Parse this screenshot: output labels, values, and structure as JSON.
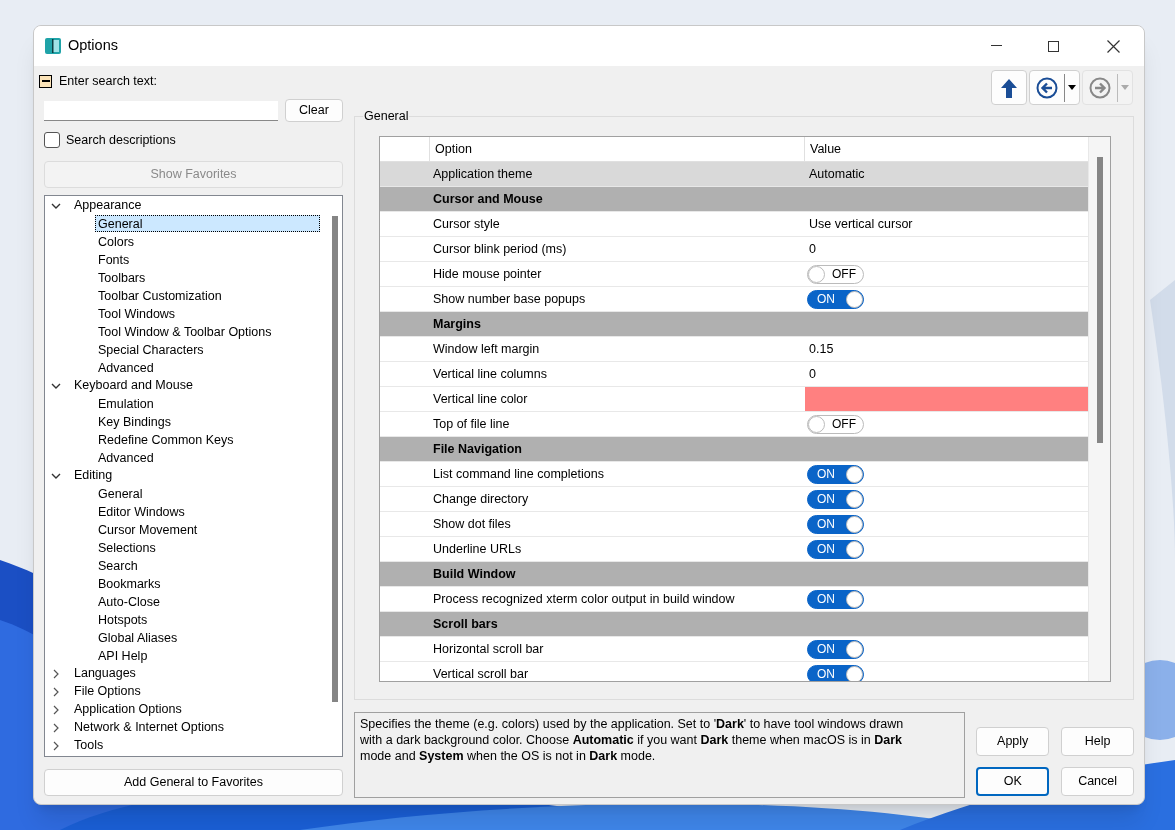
{
  "window": {
    "title": "Options"
  },
  "search": {
    "label": "Enter search text:",
    "expanded": true,
    "clear_button": "Clear",
    "descriptions": {
      "label": "Search descriptions",
      "checked": false
    },
    "show_favorites": {
      "label": "Show Favorites",
      "disabled": true
    }
  },
  "nav_buttons": [
    {
      "kind": "up",
      "disabled": false,
      "dropdown": false
    },
    {
      "kind": "back",
      "disabled": false,
      "dropdown": true
    },
    {
      "kind": "forward",
      "disabled": true,
      "dropdown": true
    }
  ],
  "tree": [
    {
      "label": "Appearance",
      "expanded": true,
      "selected": false,
      "children": [
        {
          "label": "General",
          "selected": true
        },
        {
          "label": "Colors",
          "selected": false
        },
        {
          "label": "Fonts",
          "selected": false
        },
        {
          "label": "Toolbars",
          "selected": false
        },
        {
          "label": "Toolbar Customization",
          "selected": false
        },
        {
          "label": "Tool Windows",
          "selected": false
        },
        {
          "label": "Tool Window & Toolbar Options",
          "selected": false
        },
        {
          "label": "Special Characters",
          "selected": false
        },
        {
          "label": "Advanced",
          "selected": false
        }
      ]
    },
    {
      "label": "Keyboard and Mouse",
      "expanded": true,
      "selected": false,
      "children": [
        {
          "label": "Emulation",
          "selected": false
        },
        {
          "label": "Key Bindings",
          "selected": false
        },
        {
          "label": "Redefine Common Keys",
          "selected": false
        },
        {
          "label": "Advanced",
          "selected": false
        }
      ]
    },
    {
      "label": "Editing",
      "expanded": true,
      "selected": false,
      "children": [
        {
          "label": "General",
          "selected": false
        },
        {
          "label": "Editor Windows",
          "selected": false
        },
        {
          "label": "Cursor Movement",
          "selected": false
        },
        {
          "label": "Selections",
          "selected": false
        },
        {
          "label": "Search",
          "selected": false
        },
        {
          "label": "Bookmarks",
          "selected": false
        },
        {
          "label": "Auto-Close",
          "selected": false
        },
        {
          "label": "Hotspots",
          "selected": false
        },
        {
          "label": "Global Aliases",
          "selected": false
        },
        {
          "label": "API Help",
          "selected": false
        }
      ]
    },
    {
      "label": "Languages",
      "expanded": false,
      "selected": false
    },
    {
      "label": "File Options",
      "expanded": false,
      "selected": false
    },
    {
      "label": "Application Options",
      "expanded": false,
      "selected": false
    },
    {
      "label": "Network & Internet Options",
      "expanded": false,
      "selected": false
    },
    {
      "label": "Tools",
      "expanded": false,
      "selected": false
    }
  ],
  "add_favorites_button": "Add General to Favorites",
  "group": {
    "title": "General"
  },
  "table": {
    "columns": [
      "Option",
      "Value"
    ],
    "rows": [
      {
        "kind": "text",
        "option": "Application theme",
        "value": "Automatic",
        "selected": true
      },
      {
        "kind": "section",
        "option": "Cursor and Mouse"
      },
      {
        "kind": "text",
        "option": "Cursor style",
        "value": "Use vertical cursor",
        "selected": false
      },
      {
        "kind": "text",
        "option": "Cursor blink period (ms)",
        "value": "0",
        "selected": false
      },
      {
        "kind": "toggle",
        "option": "Hide mouse pointer",
        "on": false,
        "value": "OFF",
        "selected": false
      },
      {
        "kind": "toggle",
        "option": "Show number base popups",
        "on": true,
        "value": "ON",
        "selected": false
      },
      {
        "kind": "section",
        "option": "Margins"
      },
      {
        "kind": "text",
        "option": "Window left margin",
        "value": "0.15",
        "selected": false
      },
      {
        "kind": "text",
        "option": "Vertical line columns",
        "value": "0",
        "selected": false
      },
      {
        "kind": "color",
        "option": "Vertical line color",
        "color": "#ff8080",
        "selected": false
      },
      {
        "kind": "toggle",
        "option": "Top of file line",
        "on": false,
        "value": "OFF",
        "selected": false
      },
      {
        "kind": "section",
        "option": "File Navigation"
      },
      {
        "kind": "toggle",
        "option": "List command line completions",
        "on": true,
        "value": "ON",
        "selected": false
      },
      {
        "kind": "toggle",
        "option": "Change directory",
        "on": true,
        "value": "ON",
        "selected": false
      },
      {
        "kind": "toggle",
        "option": "Show dot files",
        "on": true,
        "value": "ON",
        "selected": false
      },
      {
        "kind": "toggle",
        "option": "Underline URLs",
        "on": true,
        "value": "ON",
        "selected": false
      },
      {
        "kind": "section",
        "option": "Build Window"
      },
      {
        "kind": "toggle",
        "option": "Process recognized xterm color output in build window",
        "on": true,
        "value": "ON",
        "selected": false
      },
      {
        "kind": "section",
        "option": "Scroll bars"
      },
      {
        "kind": "toggle",
        "option": "Horizontal scroll bar",
        "on": true,
        "value": "ON",
        "selected": false
      },
      {
        "kind": "toggle",
        "option": "Vertical scroll bar",
        "on": true,
        "value": "ON",
        "selected": false
      }
    ]
  },
  "description": "Specifies the theme (e.g. colors) used by the application. Set to '**Dark**' to have tool windows drawn with a dark background color. Choose **Automatic** if you want **Dark** theme when macOS is in **Dark** mode and **System** when the OS is not in **Dark** mode.",
  "buttons": [
    {
      "label": "Apply",
      "default": false
    },
    {
      "label": "Help",
      "default": false
    },
    {
      "label": "OK",
      "default": true
    },
    {
      "label": "Cancel",
      "default": false
    }
  ]
}
